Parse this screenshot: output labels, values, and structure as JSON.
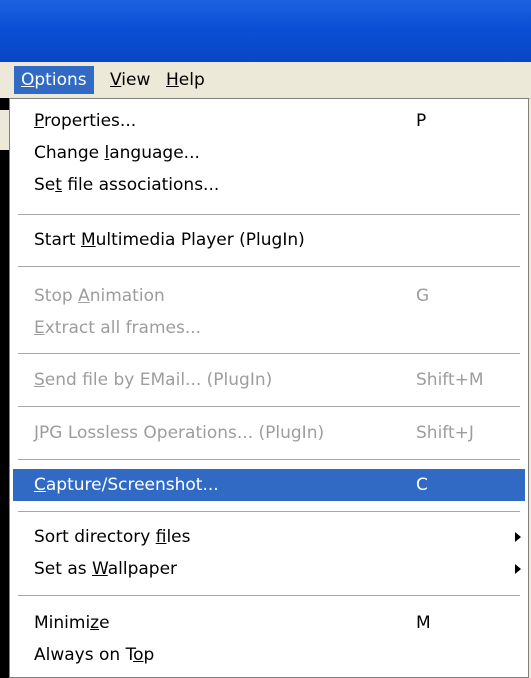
{
  "menubar": {
    "items": [
      {
        "pre": "",
        "key": "O",
        "post": "ptions"
      },
      {
        "pre": "",
        "key": "V",
        "post": "iew"
      },
      {
        "pre": "",
        "key": "H",
        "post": "elp"
      }
    ]
  },
  "menu": {
    "items": [
      {
        "pre": "",
        "key": "P",
        "post": "roperties...",
        "accel": "P"
      },
      {
        "pre": "Change ",
        "key": "l",
        "post": "anguage..."
      },
      {
        "pre": "Se",
        "key": "t",
        "post": " file associations..."
      },
      {
        "pre": "Start ",
        "key": "M",
        "post": "ultimedia Player (PlugIn)"
      },
      {
        "pre": "Stop ",
        "key": "A",
        "post": "nimation",
        "accel": "G"
      },
      {
        "pre": "",
        "key": "E",
        "post": "xtract all frames..."
      },
      {
        "pre": "",
        "key": "S",
        "post": "end file by EMail... (PlugIn)",
        "accel": "Shift+M"
      },
      {
        "pre": "",
        "key": "J",
        "post": "PG Lossless Operations... (PlugIn)",
        "accel": "Shift+J"
      },
      {
        "pre": "",
        "key": "C",
        "post": "apture/Screenshot...",
        "accel": "C"
      },
      {
        "pre": "Sort directory ",
        "key": "f",
        "post": "iles"
      },
      {
        "pre": "Set as ",
        "key": "W",
        "post": "allpaper"
      },
      {
        "pre": "Minimi",
        "key": "z",
        "post": "e",
        "accel": "M"
      },
      {
        "pre": "Always on T",
        "key": "o",
        "post": "p"
      }
    ]
  }
}
